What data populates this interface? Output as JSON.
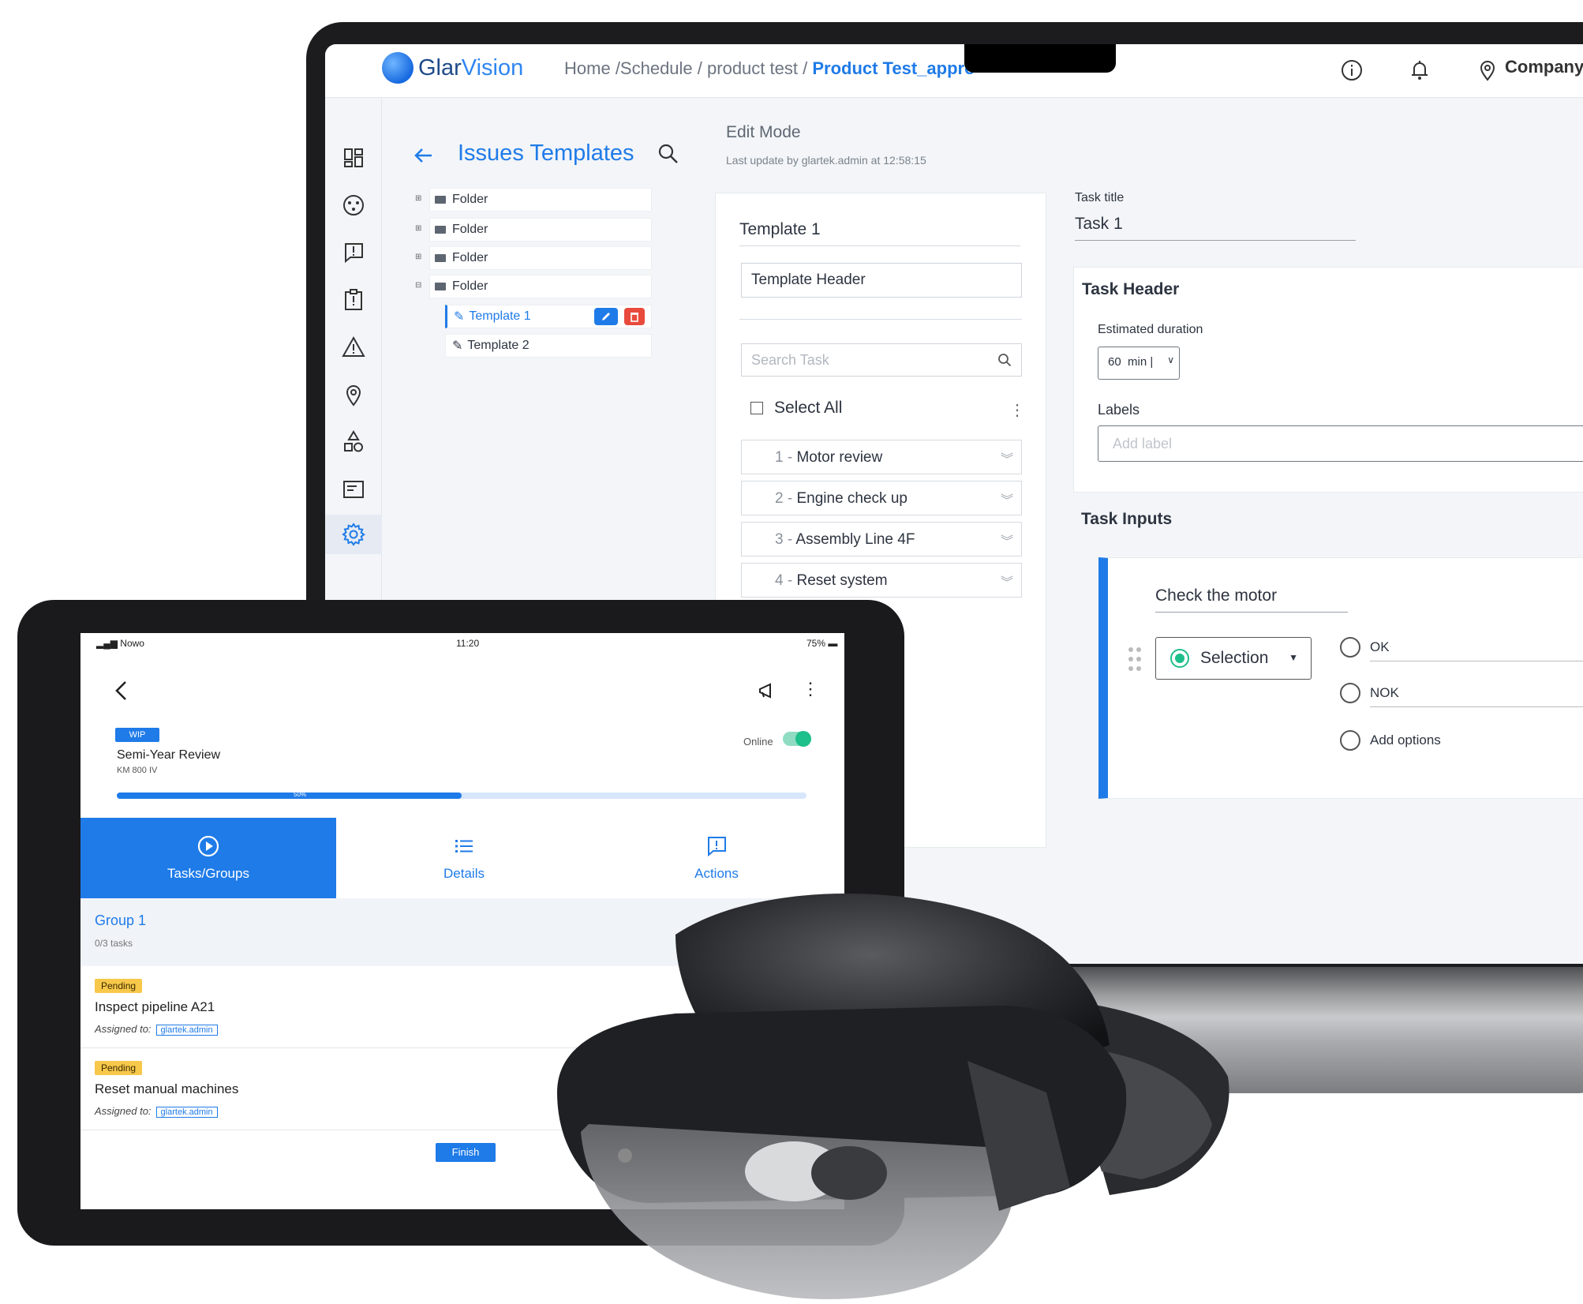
{
  "laptop": {
    "brand": {
      "glar": "Glar",
      "vision": "Vision"
    },
    "breadcrumb": {
      "home": "Home",
      "schedule": "/Schedule",
      "product_test": "/ product test /",
      "current": "Product Test_appro"
    },
    "user": "Company",
    "left_panel": {
      "title": "Issues Templates",
      "folders": [
        "Folder",
        "Folder",
        "Folder",
        "Folder"
      ],
      "templates": [
        "Template 1",
        "Template 2"
      ]
    },
    "edit_mode": "Edit Mode",
    "last_update": "Last update by glartek.admin at 12:58:15",
    "template_panel": {
      "name": "Template 1",
      "header": "Template Header",
      "search_placeholder": "Search Task",
      "select_all": "Select All",
      "tasks": [
        {
          "num": "1 -",
          "name": "Motor review"
        },
        {
          "num": "2 -",
          "name": "Engine check up"
        },
        {
          "num": "3 -",
          "name": "Assembly Line 4F"
        },
        {
          "num": "4 -",
          "name": "Reset system"
        }
      ]
    },
    "task": {
      "title_label": "Task title",
      "title_value": "Task 1",
      "header_title": "Task Header",
      "estimated_duration_label": "Estimated duration",
      "estimated_duration_value": "60",
      "estimated_duration_unit": "min |",
      "labels_label": "Labels",
      "labels_placeholder": "Add label",
      "inputs_title": "Task Inputs",
      "input_name": "Check the motor",
      "input_type": "Selection",
      "options": [
        "OK",
        "NOK",
        "Add options"
      ]
    }
  },
  "tablet": {
    "status": {
      "carrier": "Nowo",
      "time": "11:20",
      "battery": "75%"
    },
    "badge": "WIP",
    "title": "Semi-Year Review",
    "subtitle": "KM 800 IV",
    "online_label": "Online",
    "progress": 0.5,
    "progress_label": "50%",
    "tabs": [
      "Tasks/Groups",
      "Details",
      "Actions"
    ],
    "group": {
      "title": "Group 1",
      "subtitle": "0/3 tasks"
    },
    "items": [
      {
        "status": "Pending",
        "name": "Inspect pipeline A21",
        "assigned_label": "Assigned to:",
        "assignee": "glartek.admin"
      },
      {
        "status": "Pending",
        "name": "Reset manual machines",
        "assigned_label": "Assigned to:",
        "assignee": "glartek.admin"
      }
    ],
    "finish": "Finish"
  },
  "colors": {
    "accent": "#1f7be8",
    "success": "#1dbf8a",
    "pending": "#f7c84a",
    "danger": "#e84a3c"
  }
}
